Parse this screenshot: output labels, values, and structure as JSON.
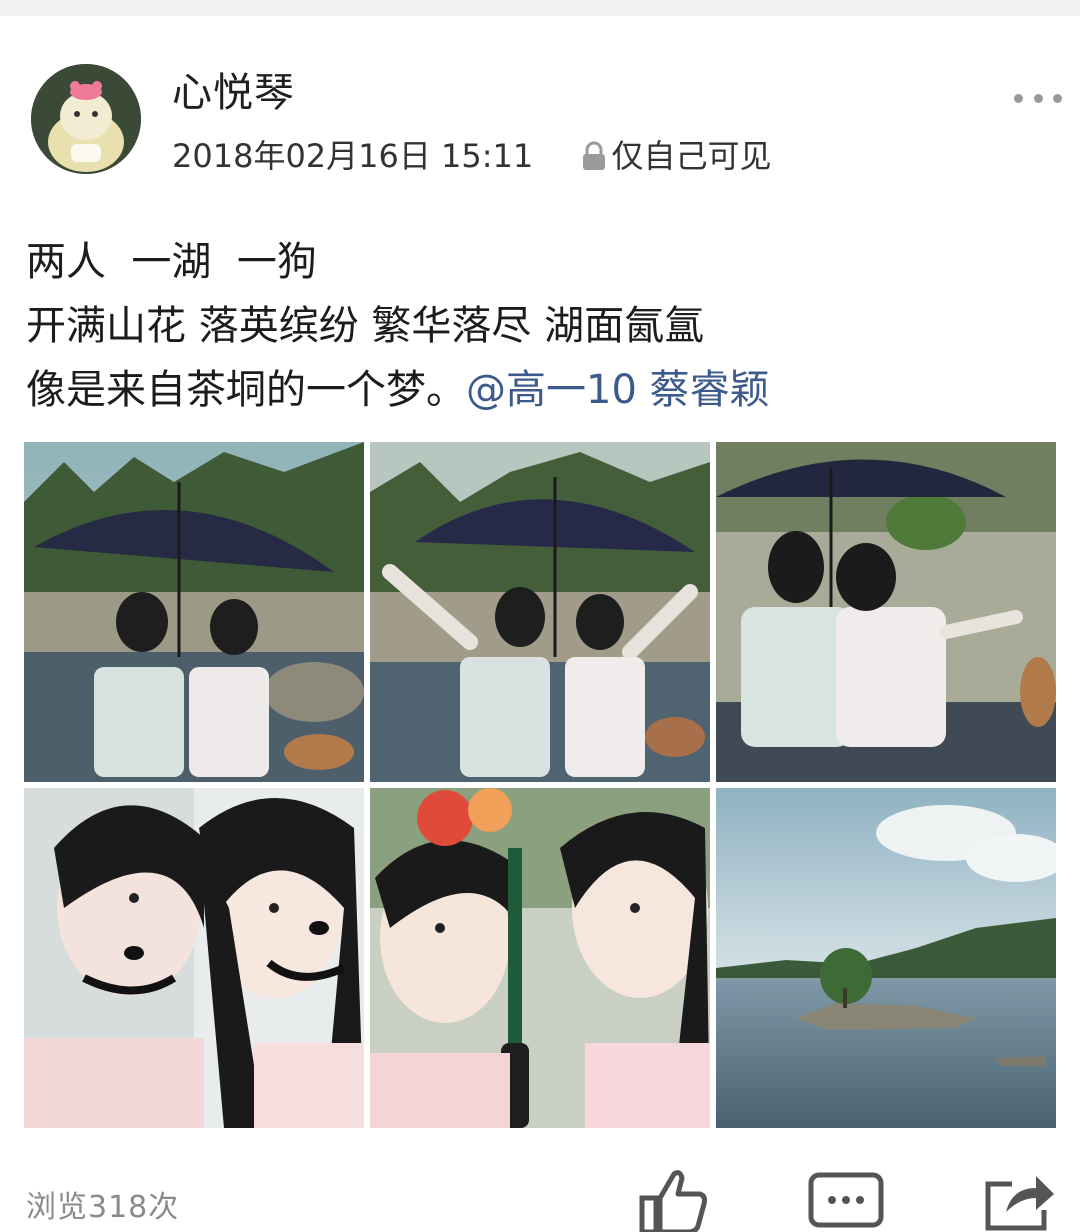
{
  "post": {
    "author": "心悦琴",
    "timestamp": "2018年02月16日 15:11",
    "privacy": "仅自己可见",
    "lines": [
      "两人  一湖  一狗",
      "开满山花 落英缤纷 繁华落尽 湖面氤氲"
    ],
    "line3_text": "像是来自茶垌的一个梦。",
    "mention": "@高一10 蔡睿颖",
    "views": "浏览318次"
  },
  "icons": {
    "more": "more-dots-icon",
    "lock": "lock-icon",
    "like": "thumbs-up-icon",
    "comment": "comment-bubble-icon",
    "share": "share-arrow-icon"
  },
  "colors": {
    "mention": "#3d5a8c",
    "meta_text": "#333333",
    "views_text": "#8a8a8a",
    "icon_gray": "#555555"
  }
}
